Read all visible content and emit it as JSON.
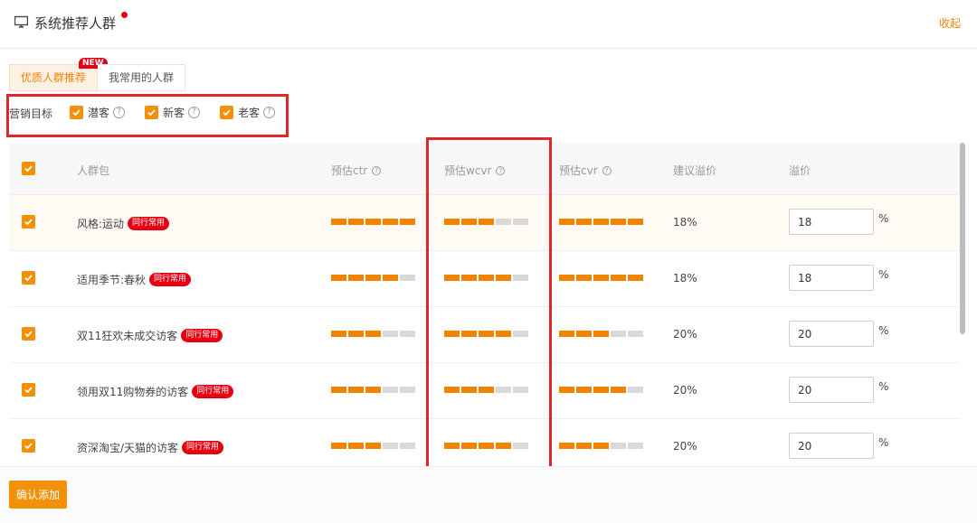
{
  "header": {
    "title": "系统推荐人群",
    "collapse_label": "收起"
  },
  "tabs": [
    {
      "label": "优质人群推荐",
      "badge": "NEW",
      "active": true
    },
    {
      "label": "我常用的人群",
      "active": false
    }
  ],
  "marketing_target": {
    "label": "营销目标",
    "options": [
      {
        "label": "潜客",
        "checked": true
      },
      {
        "label": "新客",
        "checked": true
      },
      {
        "label": "老客",
        "checked": true
      }
    ]
  },
  "table": {
    "columns": {
      "package": "人群包",
      "ctr": "预估ctr",
      "wcvr": "预估wcvr",
      "cvr": "预估cvr",
      "suggested": "建议溢价",
      "premium": "溢价"
    },
    "rows": [
      {
        "name": "风格:运动",
        "tag": "同行常用",
        "ctr_level": 5,
        "wcvr_level": 3,
        "cvr_level": 5,
        "suggested": "18%",
        "premium": "18",
        "unit": "%",
        "checked": true
      },
      {
        "name": "适用季节:春秋",
        "tag": "同行常用",
        "ctr_level": 4,
        "wcvr_level": 4,
        "cvr_level": 5,
        "suggested": "18%",
        "premium": "18",
        "unit": "%",
        "checked": true
      },
      {
        "name": "双11狂欢未成交访客",
        "tag": "同行常用",
        "ctr_level": 3,
        "wcvr_level": 4,
        "cvr_level": 3,
        "suggested": "20%",
        "premium": "20",
        "unit": "%",
        "checked": true
      },
      {
        "name": "领用双11购物券的访客",
        "tag": "同行常用",
        "ctr_level": 3,
        "wcvr_level": 3,
        "cvr_level": 4,
        "suggested": "20%",
        "premium": "20",
        "unit": "%",
        "checked": true
      },
      {
        "name": "资深淘宝/天猫的访客",
        "tag": "同行常用",
        "ctr_level": 3,
        "wcvr_level": 4,
        "cvr_level": 3,
        "suggested": "20%",
        "premium": "20",
        "unit": "%",
        "checked": true
      }
    ],
    "max_level": 5
  },
  "footer": {
    "confirm_label": "确认添加"
  },
  "colors": {
    "accent": "#f08300",
    "checkbox": "#f29107",
    "badge_red": "#e60012",
    "annotation_red": "#e0262c",
    "bar_empty": "#d9d9d9"
  }
}
